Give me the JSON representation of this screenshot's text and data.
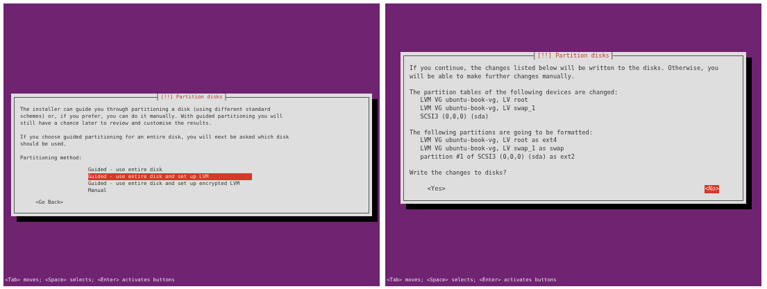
{
  "screens": [
    {
      "dialog": {
        "title": "[!!] Partition disks",
        "blocks": [
          {
            "text": "The installer can guide you through partitioning a disk (using different standard schemes) or, if you prefer, you can do it manually. With guided partitioning you will still have a chance later to review and customise the results."
          },
          {
            "text": "If you choose guided partitioning for an entire disk, you will next be asked which disk should be used."
          },
          {
            "text": "Partitioning method:"
          }
        ],
        "options": [
          {
            "label": "Guided - use entire disk",
            "selected": false
          },
          {
            "label": "Guided - use entire disk and set up LVM",
            "selected": true
          },
          {
            "label": "Guided - use entire disk and set up encrypted LVM",
            "selected": false
          },
          {
            "label": "Manual",
            "selected": false
          }
        ],
        "buttons": [
          {
            "label": "<Go Back>",
            "selected": false
          }
        ]
      },
      "status_bar": "<Tab> moves; <Space> selects; <Enter> activates buttons"
    },
    {
      "dialog": {
        "title": "[!!] Partition disks",
        "blocks": [
          {
            "text": "If you continue, the changes listed below will be written to the disks. Otherwise, you will be able to make further changes manually."
          },
          {
            "text": "The partition tables of the following devices are changed:",
            "items": [
              "LVM VG ubuntu-book-vg, LV root",
              "LVM VG ubuntu-book-vg, LV swap_1",
              "SCSI3 (0,0,0) (sda)"
            ]
          },
          {
            "text": "The following partitions are going to be formatted:",
            "items": [
              "LVM VG ubuntu-book-vg, LV root as ext4",
              "LVM VG ubuntu-book-vg, LV swap_1 as swap",
              "partition #1 of SCSI3 (0,0,0) (sda) as ext2"
            ]
          },
          {
            "text": "Write the changes to disks?"
          }
        ],
        "buttons": [
          {
            "label": "<Yes>",
            "selected": false
          },
          {
            "label": "<No>",
            "selected": true
          }
        ]
      },
      "status_bar": "<Tab> moves; <Space> selects; <Enter> activates buttons"
    }
  ]
}
